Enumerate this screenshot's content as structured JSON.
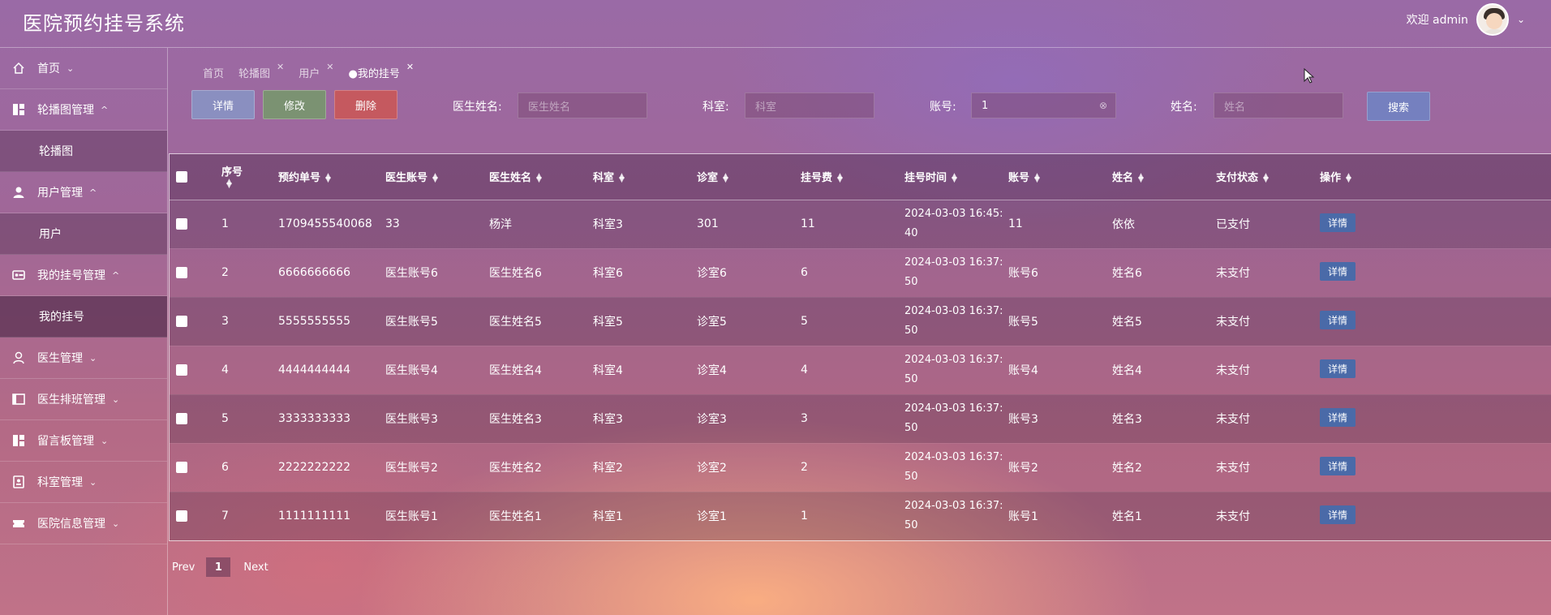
{
  "app": {
    "title": "医院预约挂号系统"
  },
  "header": {
    "welcome": "欢迎 admin"
  },
  "sidebar": {
    "items": [
      {
        "label": "首页",
        "icon": "home-icon",
        "expanded": false
      },
      {
        "label": "轮播图管理",
        "icon": "grid-icon",
        "expanded": true,
        "children": [
          "轮播图"
        ]
      },
      {
        "label": "用户管理",
        "icon": "user-icon",
        "expanded": true,
        "children": [
          "用户"
        ]
      },
      {
        "label": "我的挂号管理",
        "icon": "card-icon",
        "expanded": true,
        "children": [
          "我的挂号"
        ]
      },
      {
        "label": "医生管理",
        "icon": "doctor-icon",
        "expanded": false
      },
      {
        "label": "医生排班管理",
        "icon": "calendar-icon",
        "expanded": false
      },
      {
        "label": "留言板管理",
        "icon": "grid-icon",
        "expanded": false
      },
      {
        "label": "科室管理",
        "icon": "id-card-icon",
        "expanded": false
      },
      {
        "label": "医院信息管理",
        "icon": "ticket-icon",
        "expanded": false
      }
    ]
  },
  "tabs": [
    {
      "label": "首页",
      "closable": false
    },
    {
      "label": "轮播图",
      "closable": true
    },
    {
      "label": "用户",
      "closable": true
    },
    {
      "label": "●我的挂号",
      "closable": true,
      "active": true
    }
  ],
  "toolbar": {
    "detail": "详情",
    "edit": "修改",
    "delete": "删除",
    "search": "搜索"
  },
  "filters": {
    "doctor_name": {
      "label": "医生姓名:",
      "placeholder": "医生姓名",
      "value": ""
    },
    "department": {
      "label": "科室:",
      "placeholder": "科室",
      "value": ""
    },
    "account": {
      "label": "账号:",
      "placeholder": "账号",
      "value": "1"
    },
    "name": {
      "label": "姓名:",
      "placeholder": "姓名",
      "value": ""
    }
  },
  "table": {
    "columns": [
      "序号",
      "预约单号",
      "医生账号",
      "医生姓名",
      "科室",
      "诊室",
      "挂号费",
      "挂号时间",
      "账号",
      "姓名",
      "支付状态",
      "操作"
    ],
    "action_label": "详情",
    "rows": [
      [
        "1",
        "1709455540068",
        "33",
        "杨洋",
        "科室3",
        "301",
        "11",
        "2024-03-03 16:45:40",
        "11",
        "依依",
        "已支付"
      ],
      [
        "2",
        "6666666666",
        "医生账号6",
        "医生姓名6",
        "科室6",
        "诊室6",
        "6",
        "2024-03-03 16:37:50",
        "账号6",
        "姓名6",
        "未支付"
      ],
      [
        "3",
        "5555555555",
        "医生账号5",
        "医生姓名5",
        "科室5",
        "诊室5",
        "5",
        "2024-03-03 16:37:50",
        "账号5",
        "姓名5",
        "未支付"
      ],
      [
        "4",
        "4444444444",
        "医生账号4",
        "医生姓名4",
        "科室4",
        "诊室4",
        "4",
        "2024-03-03 16:37:50",
        "账号4",
        "姓名4",
        "未支付"
      ],
      [
        "5",
        "3333333333",
        "医生账号3",
        "医生姓名3",
        "科室3",
        "诊室3",
        "3",
        "2024-03-03 16:37:50",
        "账号3",
        "姓名3",
        "未支付"
      ],
      [
        "6",
        "2222222222",
        "医生账号2",
        "医生姓名2",
        "科室2",
        "诊室2",
        "2",
        "2024-03-03 16:37:50",
        "账号2",
        "姓名2",
        "未支付"
      ],
      [
        "7",
        "1111111111",
        "医生账号1",
        "医生姓名1",
        "科室1",
        "诊室1",
        "1",
        "2024-03-03 16:37:50",
        "账号1",
        "姓名1",
        "未支付"
      ]
    ]
  },
  "pagination": {
    "prev": "Prev",
    "current": "1",
    "next": "Next"
  },
  "colors": {
    "accent_blue": "#4a6aa8",
    "delete_red": "#c5595f",
    "edit_green": "#7b9272",
    "detail_purple": "#8a8fc0"
  }
}
